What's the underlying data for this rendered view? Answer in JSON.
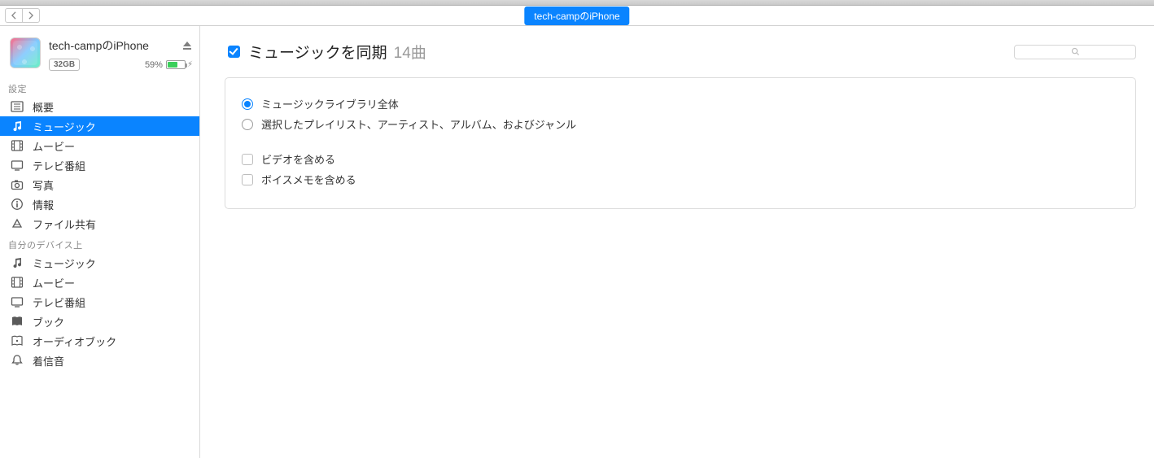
{
  "title_pill": "tech-campのiPhone",
  "device": {
    "name": "tech-campのiPhone",
    "storage": "32GB",
    "battery_pct": "59%"
  },
  "sidebar": {
    "section1": "設定",
    "settings": [
      {
        "id": "summary",
        "label": "概要",
        "icon": "summary"
      },
      {
        "id": "music",
        "label": "ミュージック",
        "icon": "music",
        "active": true
      },
      {
        "id": "movies",
        "label": "ムービー",
        "icon": "film"
      },
      {
        "id": "tv",
        "label": "テレビ番組",
        "icon": "tv"
      },
      {
        "id": "photos",
        "label": "写真",
        "icon": "camera"
      },
      {
        "id": "info",
        "label": "情報",
        "icon": "info"
      },
      {
        "id": "files",
        "label": "ファイル共有",
        "icon": "apps"
      }
    ],
    "section2": "自分のデバイス上",
    "on_device": [
      {
        "id": "music2",
        "label": "ミュージック",
        "icon": "music"
      },
      {
        "id": "movies2",
        "label": "ムービー",
        "icon": "film"
      },
      {
        "id": "tv2",
        "label": "テレビ番組",
        "icon": "tv"
      },
      {
        "id": "books",
        "label": "ブック",
        "icon": "book"
      },
      {
        "id": "audiob",
        "label": "オーディオブック",
        "icon": "audiobook"
      },
      {
        "id": "tones",
        "label": "着信音",
        "icon": "bell"
      }
    ]
  },
  "main": {
    "sync_label": "ミュージックを同期",
    "count_label": "14曲",
    "radio_all": "ミュージックライブラリ全体",
    "radio_selected": "選択したプレイリスト、アーティスト、アルバム、およびジャンル",
    "include_videos": "ビデオを含める",
    "include_voice": "ボイスメモを含める"
  }
}
